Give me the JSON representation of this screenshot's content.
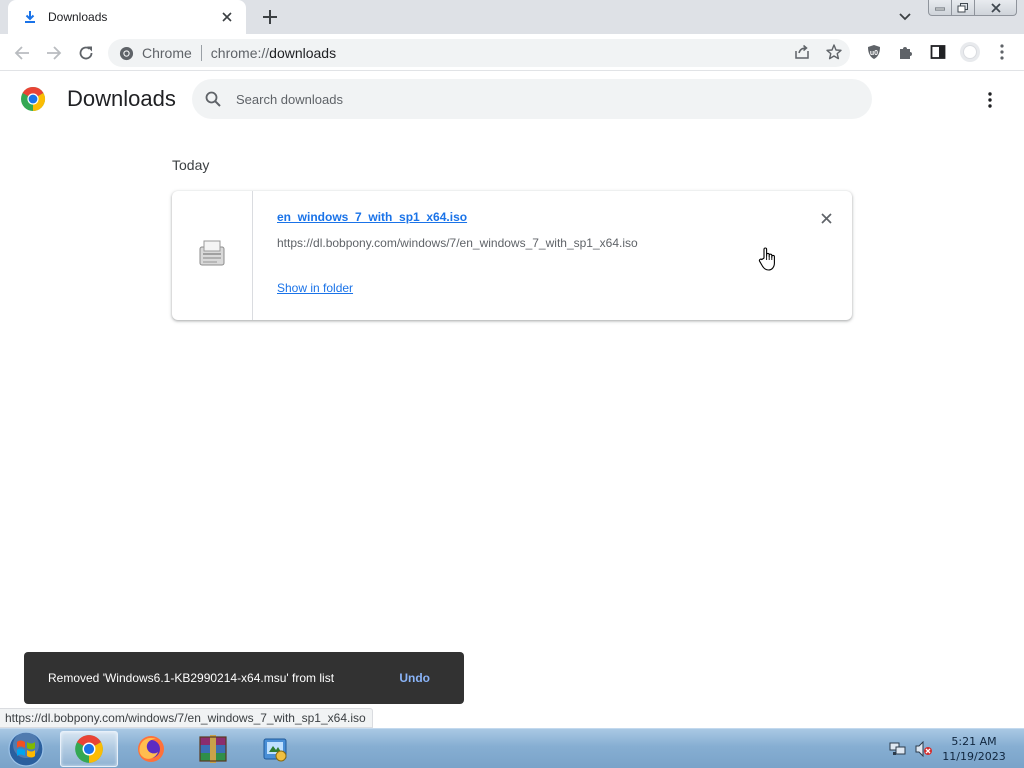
{
  "tab": {
    "title": "Downloads"
  },
  "omnibox": {
    "chip_label": "Chrome",
    "url_scheme": "chrome://",
    "url_path": "downloads"
  },
  "page": {
    "title": "Downloads",
    "search_placeholder": "Search downloads"
  },
  "downloads": {
    "section_label": "Today",
    "items": [
      {
        "file_name": "en_windows_7_with_sp1_x64.iso",
        "url": "https://dl.bobpony.com/windows/7/en_windows_7_with_sp1_x64.iso",
        "action_label": "Show in folder"
      }
    ]
  },
  "toast": {
    "message": "Removed 'Windows6.1-KB2990214-x64.msu' from list",
    "undo_label": "Undo"
  },
  "status_bar": {
    "url": "https://dl.bobpony.com/windows/7/en_windows_7_with_sp1_x64.iso"
  },
  "taskbar": {
    "apps": [
      {
        "icon": "chrome-icon",
        "active": true
      },
      {
        "icon": "firefox-icon",
        "active": false
      },
      {
        "icon": "winrar-icon",
        "active": false
      },
      {
        "icon": "control-panel-icon",
        "active": false
      }
    ],
    "clock": {
      "time": "5:21 AM",
      "date": "11/19/2023"
    }
  },
  "colors": {
    "link": "#1a73e8",
    "toast_bg": "#323232",
    "toast_action": "#8ab4f8",
    "tab_strip": "#dee1e6",
    "omnibox_bg": "#f1f3f4"
  }
}
